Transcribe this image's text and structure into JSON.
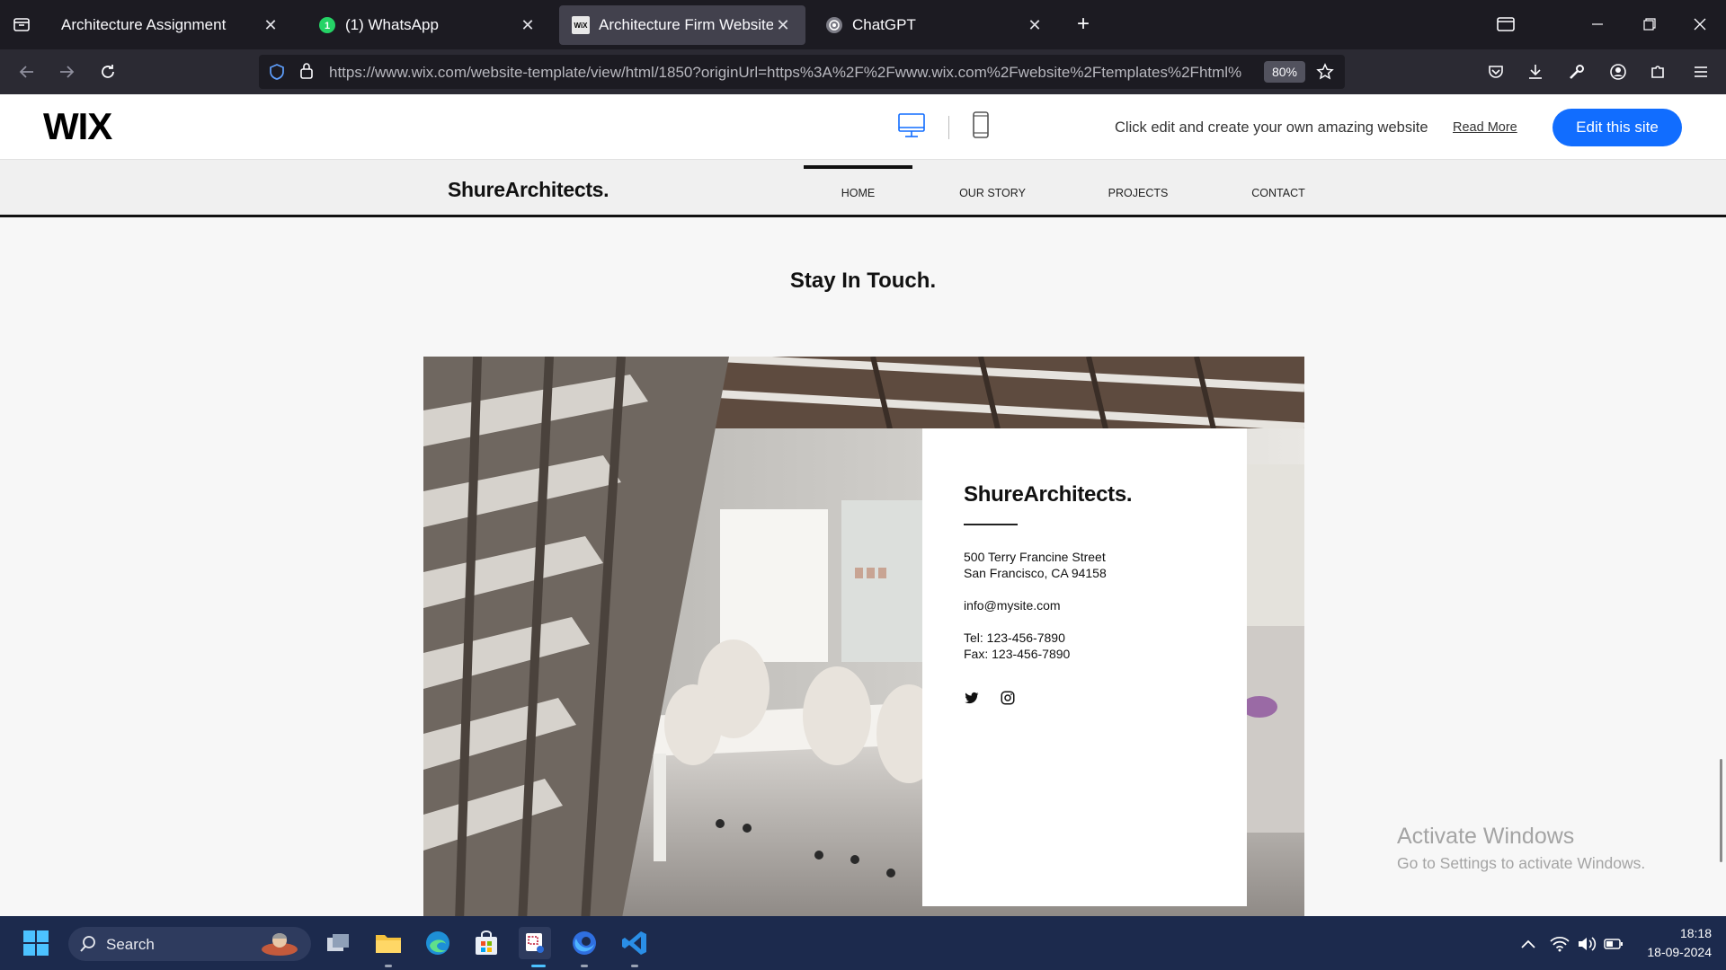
{
  "browser": {
    "tabs": [
      {
        "title": "Architecture Assignment",
        "icon": "tab-overview-icon",
        "active": false
      },
      {
        "title": "(1) WhatsApp",
        "icon": "whatsapp-icon",
        "badge": "1",
        "active": false
      },
      {
        "title": "Architecture Firm Website Temp",
        "icon": "wix-favicon",
        "favicon_text": "WiX",
        "active": true
      },
      {
        "title": "ChatGPT",
        "icon": "chatgpt-icon",
        "active": false
      }
    ],
    "url": "https://www.wix.com/website-template/view/html/1850?originUrl=https%3A%2F%2Fwww.wix.com%2Fwebsite%2Ftemplates%2Fhtml%",
    "zoom": "80%"
  },
  "wix_header": {
    "logo": "WIX",
    "promo_text": "Click edit and create your own amazing website",
    "read_more": "Read More",
    "edit_button": "Edit this site",
    "accent": "#116dff"
  },
  "site": {
    "logo": "ShureArchitects.",
    "nav": [
      {
        "label": "HOME",
        "active": true
      },
      {
        "label": "OUR STORY"
      },
      {
        "label": "PROJECTS"
      },
      {
        "label": "CONTACT"
      }
    ],
    "section_title": "Stay In Touch.",
    "contact": {
      "brand": "ShureArchitects.",
      "address_line1": "500 Terry Francine Street",
      "address_line2": "San Francisco, CA 94158",
      "email": "info@mysite.com",
      "tel": "Tel: 123-456-7890",
      "fax": "Fax: 123-456-7890",
      "social": [
        "twitter-icon",
        "instagram-icon"
      ]
    }
  },
  "watermark": {
    "title": "Activate Windows",
    "subtitle": "Go to Settings to activate Windows."
  },
  "taskbar": {
    "search_placeholder": "Search",
    "time": "18:18",
    "date": "18-09-2024"
  }
}
